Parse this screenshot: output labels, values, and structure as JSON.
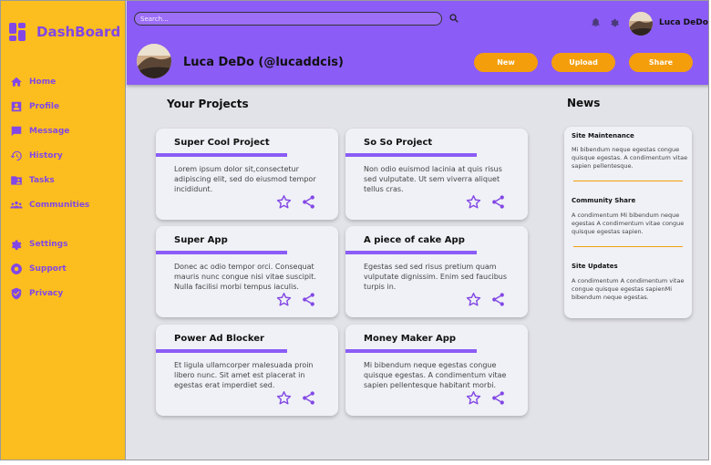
{
  "sidebar": {
    "brand": "DashBoard",
    "items": [
      {
        "label": "Home",
        "icon": "home-icon"
      },
      {
        "label": "Profile",
        "icon": "profile-icon"
      },
      {
        "label": "Message",
        "icon": "message-icon"
      },
      {
        "label": "History",
        "icon": "history-icon"
      },
      {
        "label": "Tasks",
        "icon": "tasks-icon"
      },
      {
        "label": "Communities",
        "icon": "communities-icon"
      },
      {
        "label": "Settings",
        "icon": "settings-icon"
      },
      {
        "label": "Support",
        "icon": "support-icon"
      },
      {
        "label": "Privacy",
        "icon": "privacy-icon"
      }
    ]
  },
  "header": {
    "search_placeholder": "Search...",
    "username": "Luca DeDo",
    "profile_name": "Luca DeDo (@lucaddcis)",
    "buttons": {
      "new": "New",
      "upload": "Upload",
      "share": "Share"
    }
  },
  "projects": {
    "title": "Your Projects",
    "items": [
      {
        "title": "Super Cool Project",
        "desc": "Lorem ipsum dolor sit,consectetur adipiscing elit, sed do eiusmod tempor incididunt."
      },
      {
        "title": "So So Project",
        "desc": "Non odio euismod lacinia at quis risus sed vulputate. Ut sem viverra aliquet tellus cras."
      },
      {
        "title": "Super App",
        "desc": "Donec ac odio tempor orci. Consequat mauris nunc congue nisi vitae suscipit. Nulla facilisi morbi tempus iaculis."
      },
      {
        "title": "A piece of cake App",
        "desc": "Egestas sed sed risus pretium quam vulputate dignissim. Enim sed faucibus turpis in."
      },
      {
        "title": "Power Ad Blocker",
        "desc": "Et ligula ullamcorper malesuada proin libero nunc. Sit amet est placerat in egestas erat imperdiet sed."
      },
      {
        "title": "Money Maker App",
        "desc": "Mi bibendum neque egestas congue quisque egestas. A condimentum vitae sapien pellentesque habitant morbi."
      }
    ]
  },
  "news": {
    "title": "News",
    "items": [
      {
        "title": "Site Maintenance",
        "text": "Mi bibendum neque egestas congue quisque egestas. A condimentum vitae sapien pellentesque."
      },
      {
        "title": "Community Share",
        "text": "A condimentum Mi bibendum neque egestas A condimentum vitae congue quisque egestas sapien."
      },
      {
        "title": "Site Updates",
        "text": "A condimentum A condimentum vitae congue quisque egestas sapienMi bibendum neque egestas."
      }
    ]
  },
  "colors": {
    "sidebar_bg": "#fbbe1e",
    "header_bg": "#8b5cf6",
    "accent_purple": "#8247e5",
    "button_orange": "#f59e0b",
    "content_bg": "#e2e3e8",
    "card_bg": "#eff1f6"
  }
}
